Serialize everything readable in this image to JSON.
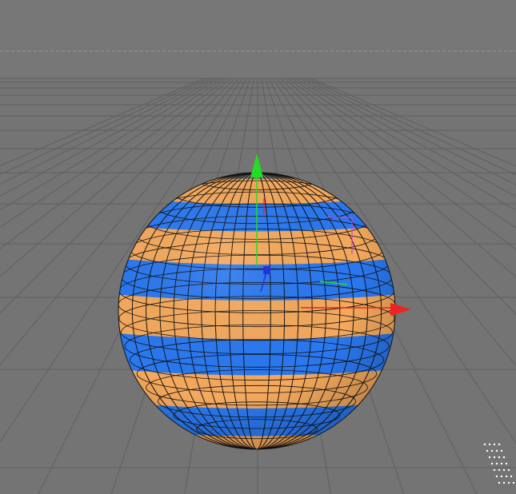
{
  "viewport": {
    "background_color": "#777777",
    "ground_color": "#747474",
    "grid_color": "#5f5f5f",
    "horizon_dash_color": "#9a9a9a"
  },
  "sphere": {
    "stripe_colors": [
      "#f4a95d",
      "#2a78f0",
      "#f4a95d",
      "#2a78f0",
      "#f4a95d",
      "#2a78f0",
      "#f4a95d",
      "#2a78f0",
      "#f4a95d"
    ],
    "wire_color": "#111111"
  },
  "gizmo": {
    "y_axis_color": "#22dd22",
    "x_axis_color": "#ee2222",
    "z_axis_color": "#2233dd",
    "rotate_handle_color": "#cc44cc"
  },
  "icons": {
    "corner_indicator": "dotted-corner-icon"
  }
}
